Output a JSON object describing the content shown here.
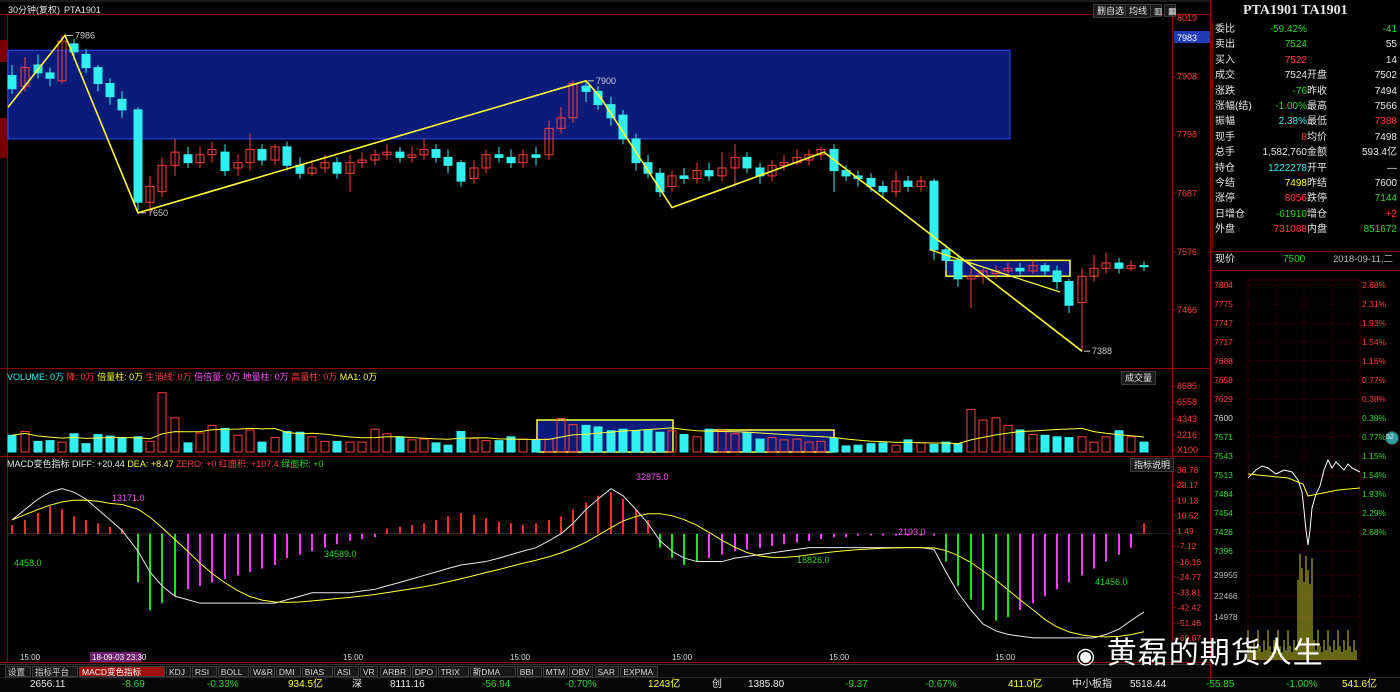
{
  "colors": {
    "up": "#ff3c3c",
    "down": "#33f0f0",
    "yellow": "#ffff32",
    "box": "#0a1b7a",
    "grid": "#8b0000",
    "pos": "#ff2b2b",
    "neg_green": "#19e619",
    "neg_mag": "#ff38ff"
  },
  "toolbar": {
    "title": "30分钟(复权)",
    "symbol": "PTA1901",
    "buttons": [
      "删自选",
      "均线",
      "",
      "",
      ""
    ]
  },
  "price_axis": {
    "labels": [
      "8019",
      "7983",
      "7908",
      "7798",
      "7687",
      "7576",
      "7466"
    ],
    "current": "7983"
  },
  "annotations": {
    "high1": "7986",
    "low1": "7650",
    "high2": "7900",
    "low2": "7388"
  },
  "volume": {
    "header": {
      "volume": "VOLUME: 0万",
      "drop": "降: 0万",
      "double": "倍量柱: 0万",
      "rising": "生消线: 0万",
      "down_double": "倍倍量: 0万",
      "floor": "地量柱: 0万",
      "high": "高量柱: 0万",
      "ma": "MA1: 0万"
    },
    "button": "成交量",
    "axis": [
      "8685",
      "6558",
      "4343",
      "2216",
      "X100"
    ]
  },
  "macd": {
    "header": {
      "name": "MACD变色指标",
      "diff": "DIFF: +20.44",
      "dea": "DEA: +8.47",
      "zero": "ZERO: +0",
      "red": "红面积: +107.4",
      "green": "绿面积: +0"
    },
    "button": "指标说明",
    "axis": [
      "36.78",
      "28.17",
      "19.13",
      "10.52",
      "1.49",
      "-7.12",
      "-16.16",
      "-24.77",
      "-33.81",
      "-42.42",
      "-51.46",
      "-60.07"
    ],
    "labels": {
      "a": "13171.0",
      "b": "4458.0",
      "c": "34589.0",
      "d": "32875.0",
      "e": "2193.0",
      "f": "16826.0",
      "g": "41456.0"
    }
  },
  "time_axis": [
    "15:00",
    "18-09-03 23:30",
    "15:00",
    "15:00",
    "15:00",
    "15:00",
    "15:00"
  ],
  "indicator_tabs": [
    "设置",
    "指标平台",
    "MACD变色指标",
    "KDJ",
    "RSI",
    "BOLL",
    "W&R",
    "DMI",
    "BIAS",
    "ASI",
    "VR",
    "ARBR",
    "DPO",
    "TRIX",
    "新DMA",
    "BBI",
    "MTM",
    "OBV",
    "SAR",
    "EXPMA"
  ],
  "quote": {
    "title": "PTA1901 TA1901",
    "rows": [
      {
        "k": "委比",
        "v": "-59.42%",
        "k2": "",
        "v2": "-41"
      },
      {
        "k": "卖出",
        "v": "7524",
        "k2": "",
        "v2": "55"
      },
      {
        "k": "买入",
        "v": "7522",
        "k2": "",
        "v2": "14"
      },
      {
        "k": "成交",
        "v": "7524",
        "k2": "开盘",
        "v2": "7502"
      },
      {
        "k": "涨跌",
        "v": "-76",
        "k2": "昨收",
        "v2": "7494"
      },
      {
        "k": "涨幅(结)",
        "v": "-1.00%",
        "k2": "最高",
        "v2": "7566"
      },
      {
        "k": "振幅",
        "v": "2.38%",
        "k2": "最低",
        "v2": "7388"
      },
      {
        "k": "现手",
        "v": "8",
        "k2": "均价",
        "v2": "7498"
      },
      {
        "k": "总手",
        "v": "1,582,760",
        "k2": "金额",
        "v2": "593.4亿"
      },
      {
        "k": "持仓",
        "v": "1222278",
        "k2": "开平",
        "v2": "—"
      },
      {
        "k": "今结",
        "v": "7498",
        "k2": "昨结",
        "v2": "7600"
      },
      {
        "k": "涨停",
        "v": "8056",
        "k2": "跌停",
        "v2": "7144"
      },
      {
        "k": "日增仓",
        "v": "-61910",
        "k2": "增仓",
        "v2": "+2"
      },
      {
        "k": "外盘",
        "v": "731088",
        "k2": "内盘",
        "v2": "851672"
      }
    ],
    "mini_head": {
      "label": "现价",
      "price": "7500",
      "date": "2018-09-11,二"
    },
    "mini_left": [
      "7804",
      "7775",
      "7747",
      "7717",
      "7688",
      "7658",
      "7629",
      "7600",
      "7571",
      "7543",
      "7513",
      "7484",
      "7454",
      "7426",
      "7396",
      "29955",
      "22466",
      "14978"
    ],
    "mini_right": [
      "2.68%",
      "2.31%",
      "1.93%",
      "1.54%",
      "1.16%",
      "0.77%",
      "0.38%",
      "0.38%",
      "0.77%",
      "1.15%",
      "1.54%",
      "1.93%",
      "2.29%",
      "2.68%"
    ]
  },
  "status": {
    "sh_val": "2656.11",
    "sh_chg": "-8.69",
    "sh_pct": "-0.33%",
    "sh_amt": "934.5亿",
    "sz_name": "深",
    "sz_val": "8111.16",
    "sz_chg": "-56.94",
    "sz_pct": "-0.70%",
    "sz_amt": "1243亿",
    "cy_name": "创",
    "cy_val": "1385.80",
    "cy_chg": "-9.37",
    "cy_pct": "-0.67%",
    "cy_amt": "411.0亿",
    "zx_name": "中小板指",
    "zx_val": "5518.44",
    "zx_chg": "-55.85",
    "zx_pct": "-1.00%",
    "zx_amt": "541.6亿"
  },
  "watermark": "黄磊的期货人生"
}
